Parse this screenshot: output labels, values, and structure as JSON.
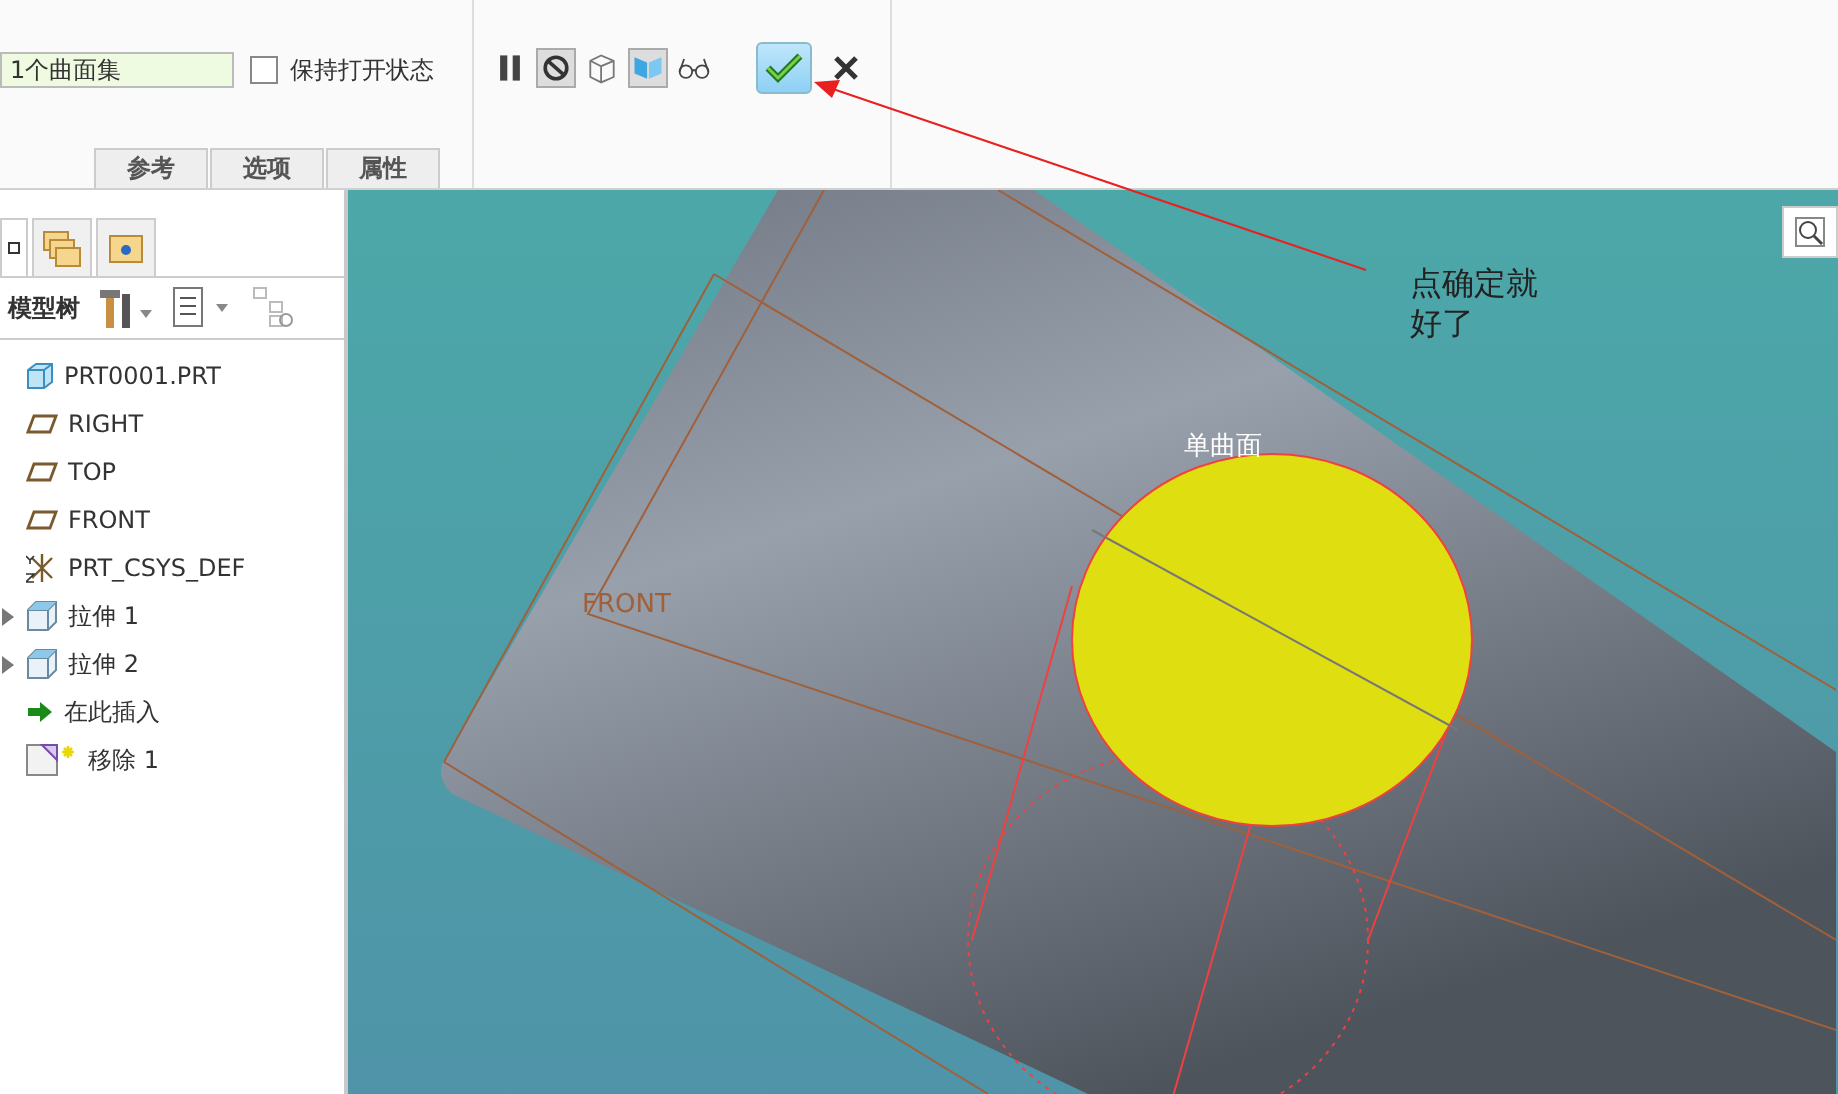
{
  "dashboard": {
    "collector": {
      "value": "1个曲面集"
    },
    "keep_open": {
      "label": "保持打开状态",
      "checked": false
    },
    "tabs": [
      {
        "label": "参考",
        "selected": false
      },
      {
        "label": "选项",
        "selected": false
      },
      {
        "label": "属性",
        "selected": false
      }
    ],
    "tools": [
      {
        "kind": "pause",
        "selected": false
      },
      {
        "kind": "no-preview",
        "selected": true
      },
      {
        "kind": "wire-preview",
        "selected": false
      },
      {
        "kind": "shaded-preview",
        "selected": true
      },
      {
        "kind": "glasses",
        "selected": false
      }
    ]
  },
  "navigator": {
    "title": "模型树",
    "items": [
      {
        "label": "PRT0001.PRT",
        "kind": "part"
      },
      {
        "label": "RIGHT",
        "kind": "plane"
      },
      {
        "label": "TOP",
        "kind": "plane"
      },
      {
        "label": "FRONT",
        "kind": "plane"
      },
      {
        "label": "PRT_CSYS_DEF",
        "kind": "csys"
      },
      {
        "label": "拉伸 1",
        "kind": "extrude",
        "expanded": false
      },
      {
        "label": "拉伸 2",
        "kind": "extrude",
        "expanded": false
      },
      {
        "label": "在此插入",
        "kind": "insert"
      },
      {
        "label": "移除 1",
        "kind": "remove"
      }
    ]
  },
  "viewport": {
    "plane_label": "FRONT",
    "surface_label": "单曲面"
  },
  "annotation": {
    "lines": [
      "点确定就",
      "好了"
    ]
  }
}
